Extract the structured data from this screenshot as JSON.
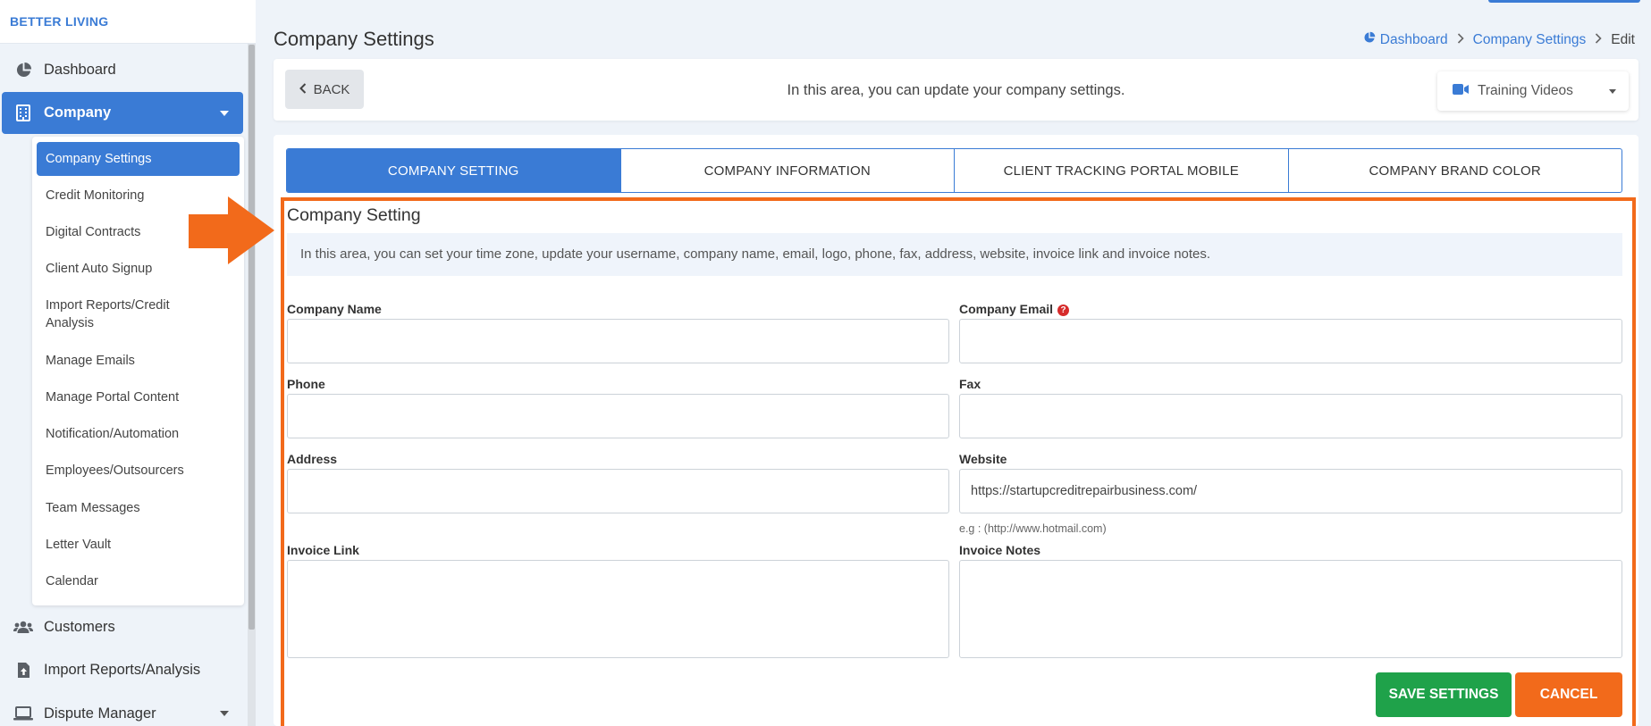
{
  "sidebar": {
    "brand": "BETTER LIVING",
    "dashboard": "Dashboard",
    "company": "Company",
    "submenu": [
      "Company Settings",
      "Credit Monitoring",
      "Digital Contracts",
      "Client Auto Signup",
      "Import Reports/Credit Analysis",
      "Manage Emails",
      "Manage Portal Content",
      "Notification/Automation",
      "Employees/Outsourcers",
      "Team Messages",
      "Letter Vault",
      "Calendar"
    ],
    "customers": "Customers",
    "import_reports": "Import Reports/Analysis",
    "dispute_manager": "Dispute Manager"
  },
  "header": {
    "title": "Company Settings",
    "breadcrumb": [
      "Dashboard",
      "Company Settings",
      "Edit"
    ]
  },
  "toolbar": {
    "back_label": "BACK",
    "info_text": "In this area, you can update your company settings.",
    "training_label": "Training Videos"
  },
  "tabs": [
    "COMPANY SETTING",
    "COMPANY INFORMATION",
    "CLIENT TRACKING PORTAL MOBILE",
    "COMPANY BRAND COLOR"
  ],
  "form": {
    "section_title": "Company Setting",
    "description": "In this area, you can set your time zone, update your username, company name, email, logo, phone, fax, address, website, invoice link and invoice notes.",
    "company_name_label": "Company Name",
    "company_name_value": "",
    "company_email_label": "Company Email",
    "company_email_value": "",
    "phone_label": "Phone",
    "phone_value": "",
    "fax_label": "Fax",
    "fax_value": "",
    "address_label": "Address",
    "address_value": "",
    "website_label": "Website",
    "website_value": "https://startupcreditrepairbusiness.com/",
    "website_help": "e.g : (http://www.hotmail.com)",
    "invoice_link_label": "Invoice Link",
    "invoice_link_value": "",
    "invoice_notes_label": "Invoice Notes",
    "invoice_notes_value": "",
    "save_label": "SAVE SETTINGS",
    "cancel_label": "CANCEL"
  },
  "colors": {
    "accent": "#3a7bd5",
    "highlight": "#f26a1b",
    "save": "#1fa24a",
    "cancel": "#f26a1b"
  }
}
